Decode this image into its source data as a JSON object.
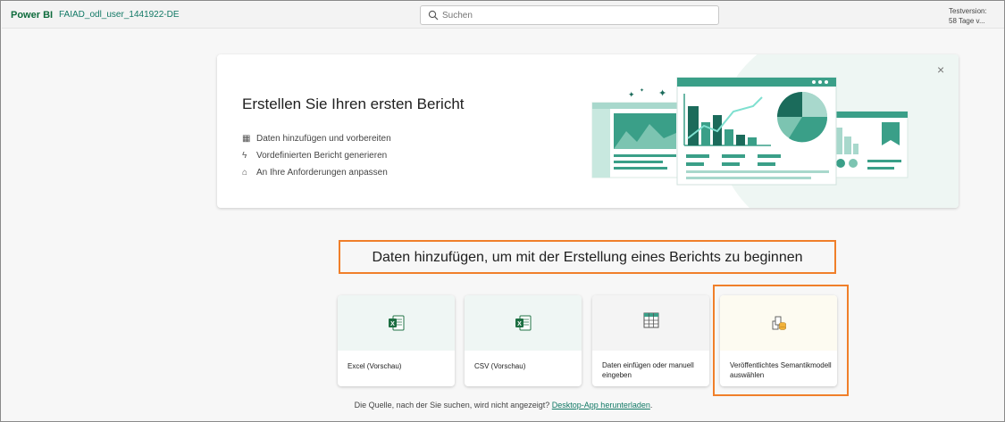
{
  "topbar": {
    "brand": "Power BI",
    "workspace": "FAIAD_odl_user_1441922-DE",
    "search_placeholder": "Suchen",
    "trial_line1": "Testversion:",
    "trial_line2": "58 Tage v..."
  },
  "banner": {
    "title": "Erstellen Sie Ihren ersten Bericht",
    "features": [
      {
        "icon": "table-icon",
        "label": "Daten hinzufügen und vorbereiten"
      },
      {
        "icon": "lightning-icon",
        "label": "Vordefinierten Bericht generieren"
      },
      {
        "icon": "paint-brush-icon",
        "label": "An Ihre Anforderungen anpassen"
      }
    ],
    "close": "×"
  },
  "main": {
    "heading": "Daten hinzufügen, um mit der Erstellung eines Berichts zu beginnen",
    "cards": [
      {
        "label": "Excel (Vorschau)",
        "icon": "excel-icon"
      },
      {
        "label": "CSV (Vorschau)",
        "icon": "csv-icon"
      },
      {
        "label": "Daten einfügen oder manuell eingeben",
        "icon": "grid-table-icon"
      },
      {
        "label": "Veröffentlichtes Semantikmodell auswählen",
        "icon": "semantic-model-icon"
      }
    ],
    "footer_text": "Die Quelle, nach der Sie suchen, wird nicht angezeigt?",
    "footer_link": "Desktop-App herunterladen",
    "footer_end": "."
  },
  "colors": {
    "brand_green": "#0e6b3c",
    "accent_teal": "#117865",
    "highlight_orange": "#f07f2a",
    "chart_teal": "#3a9f88"
  }
}
